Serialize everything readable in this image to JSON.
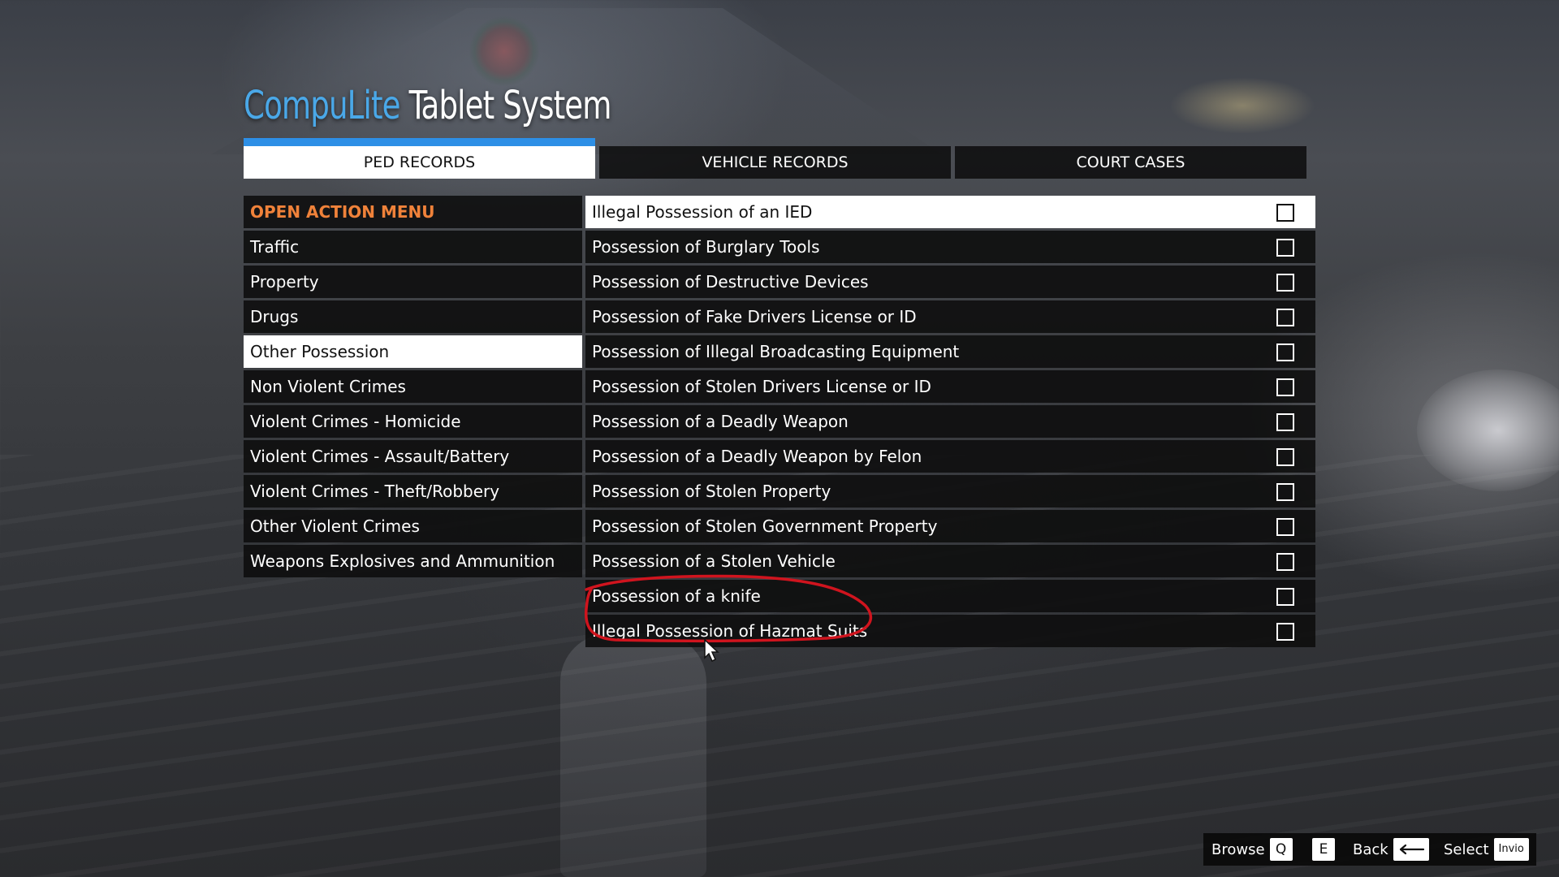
{
  "app": {
    "title_brand": "CompuLite",
    "title_rest": "Tablet System"
  },
  "tabs": [
    {
      "label": "PED RECORDS",
      "active": true
    },
    {
      "label": "VEHICLE RECORDS",
      "active": false
    },
    {
      "label": "COURT CASES",
      "active": false
    }
  ],
  "categories": [
    {
      "label": "OPEN ACTION MENU"
    },
    {
      "label": "Traffic"
    },
    {
      "label": "Property"
    },
    {
      "label": "Drugs"
    },
    {
      "label": "Other Possession"
    },
    {
      "label": "Non Violent Crimes"
    },
    {
      "label": "Violent Crimes - Homicide"
    },
    {
      "label": "Violent Crimes - Assault/Battery"
    },
    {
      "label": "Violent Crimes - Theft/Robbery"
    },
    {
      "label": "Other Violent Crimes"
    },
    {
      "label": "Weapons Explosives and Ammunition"
    }
  ],
  "selected_category": "Other Possession",
  "charges": [
    {
      "label": "Illegal Possession of an IED",
      "checked": false
    },
    {
      "label": "Possession of Burglary Tools",
      "checked": false
    },
    {
      "label": "Possession of Destructive Devices",
      "checked": false
    },
    {
      "label": "Possession of Fake Drivers License or ID",
      "checked": false
    },
    {
      "label": "Possession of Illegal Broadcasting Equipment",
      "checked": false
    },
    {
      "label": "Possession of Stolen Drivers License or ID",
      "checked": false
    },
    {
      "label": "Possession of a Deadly Weapon",
      "checked": false
    },
    {
      "label": "Possession of a Deadly Weapon by Felon",
      "checked": false
    },
    {
      "label": "Possession of Stolen Property",
      "checked": false
    },
    {
      "label": "Possession of Stolen Government Property",
      "checked": false
    },
    {
      "label": "Possession of a Stolen Vehicle",
      "checked": false
    },
    {
      "label": "Possession of a knife",
      "checked": false
    },
    {
      "label": "Illegal Possession of Hazmat Suits",
      "checked": false
    }
  ],
  "controls": {
    "browse_label": "Browse",
    "browse_key_left": "Q",
    "browse_key_right": "E",
    "back_label": "Back",
    "select_label": "Select",
    "select_key": "Invio"
  },
  "colors": {
    "brand_blue": "#4aa8e8",
    "tab_accent": "#2d8fe6",
    "header_orange": "#f0823a",
    "annotation_red": "#d0141e"
  }
}
